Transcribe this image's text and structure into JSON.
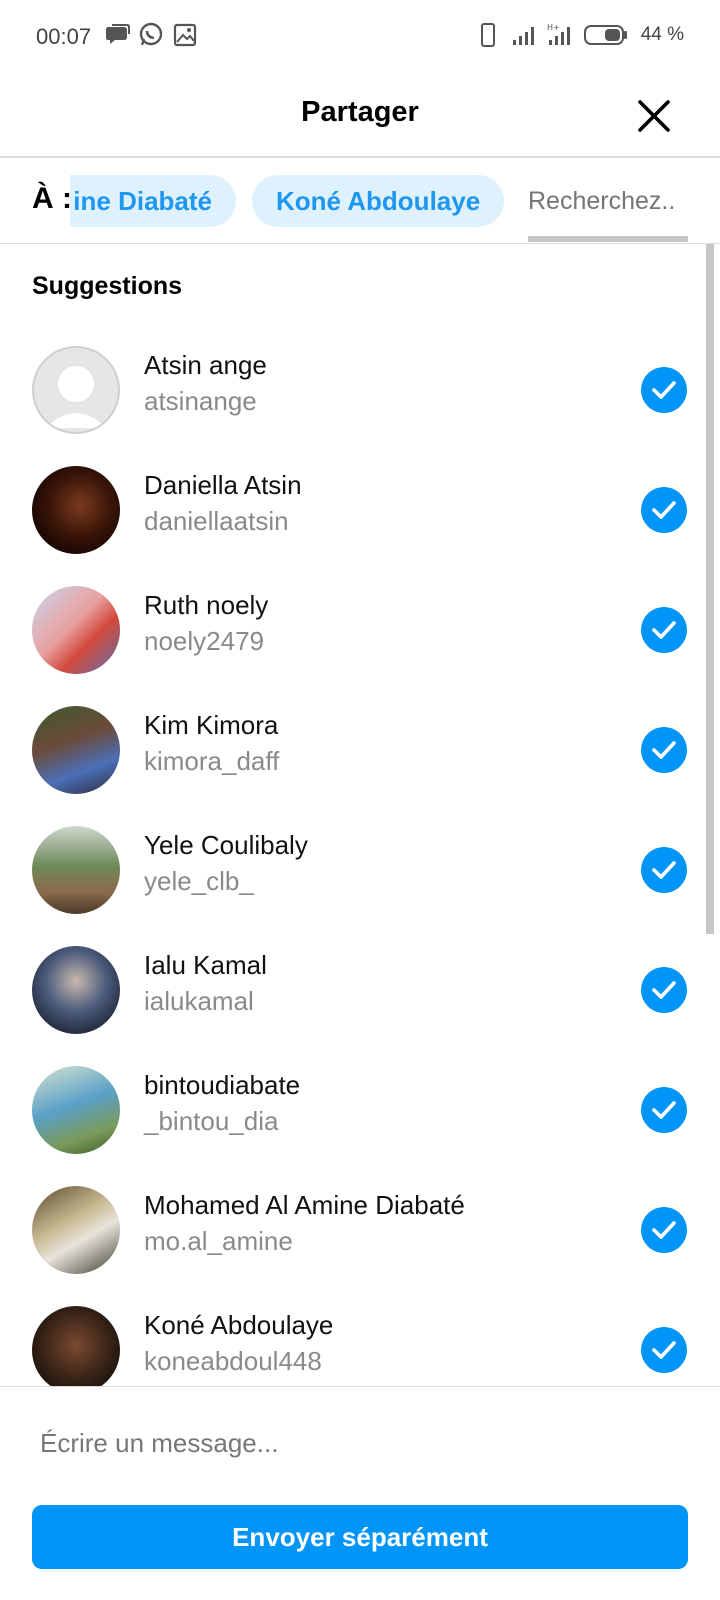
{
  "status_bar": {
    "time": "00:07",
    "battery_text": "44 %",
    "left_icons": [
      "message-bubble-icon",
      "whatsapp-icon",
      "gallery-icon"
    ],
    "right_icons": [
      "phone-outline-icon",
      "signal-icon",
      "signal-data-icon",
      "battery-icon"
    ]
  },
  "header": {
    "title": "Partager",
    "close_icon": "close-icon"
  },
  "recipients": {
    "to_label": "À :",
    "chips": [
      "ine Diabaté",
      "Koné Abdoulaye"
    ],
    "search_placeholder": "Recherchez.."
  },
  "suggestions": {
    "title": "Suggestions",
    "items": [
      {
        "name": "Atsin ange",
        "handle": "atsinange",
        "selected": true,
        "avatar": "default-avatar"
      },
      {
        "name": "Daniella Atsin",
        "handle": "daniellaatsin",
        "selected": true,
        "avatar": "photo"
      },
      {
        "name": "Ruth noely",
        "handle": "noely2479",
        "selected": true,
        "avatar": "photo"
      },
      {
        "name": "Kim Kimora",
        "handle": "kimora_daff",
        "selected": true,
        "avatar": "photo"
      },
      {
        "name": "Yele Coulibaly",
        "handle": "yele_clb_",
        "selected": true,
        "avatar": "photo"
      },
      {
        "name": "Ialu Kamal",
        "handle": "ialukamal",
        "selected": true,
        "avatar": "photo"
      },
      {
        "name": "bintoudiabate",
        "handle": "_bintou_dia",
        "selected": true,
        "avatar": "photo"
      },
      {
        "name": "Mohamed Al Amine Diabaté",
        "handle": "mo.al_amine",
        "selected": true,
        "avatar": "photo"
      },
      {
        "name": "Koné Abdoulaye",
        "handle": "koneabdoul448",
        "selected": true,
        "avatar": "photo"
      }
    ]
  },
  "footer": {
    "message_placeholder": "Écrire un message...",
    "send_label": "Envoyer séparément"
  },
  "colors": {
    "accent": "#0095f6",
    "chip_bg": "#e0f1fe",
    "chip_text": "#1e97f0"
  }
}
